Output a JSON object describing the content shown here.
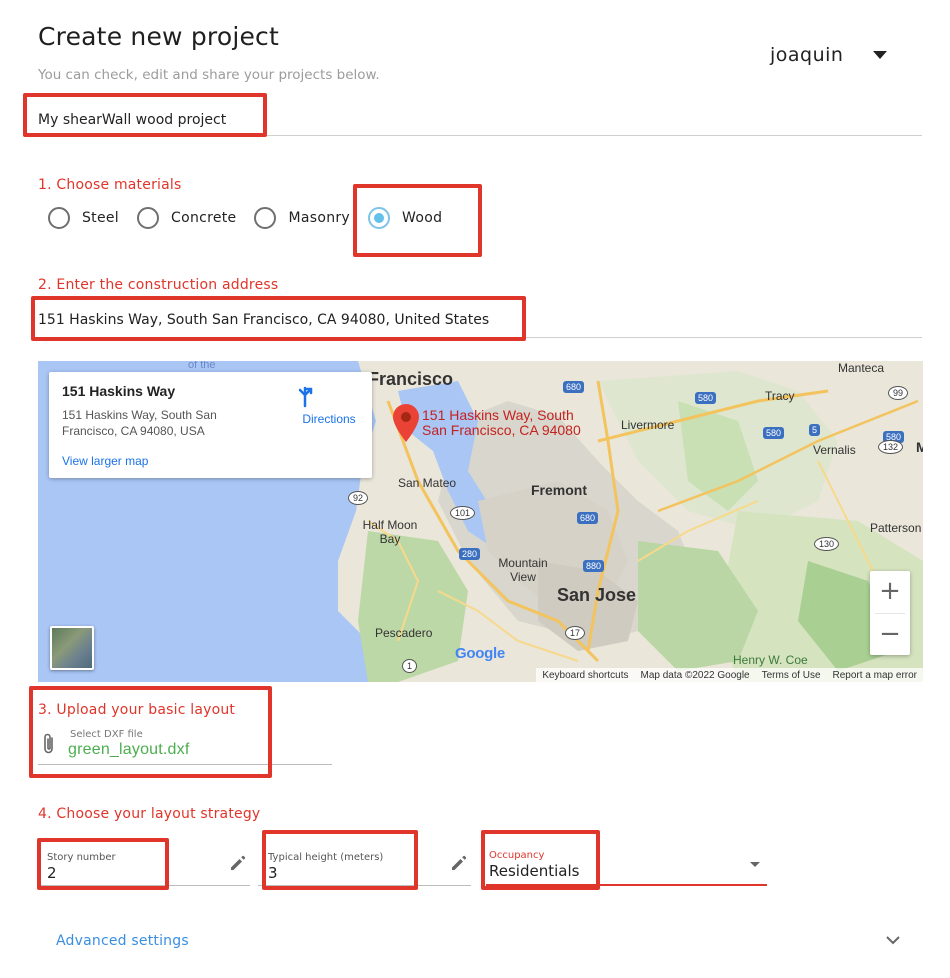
{
  "header": {
    "title": "Create new project",
    "subtitle": "You can check, edit and share your projects below.",
    "user_name": "joaquin"
  },
  "project": {
    "name": "My shearWall wood project"
  },
  "materials": {
    "label": "1. Choose materials",
    "options": [
      {
        "label": "Steel",
        "checked": false
      },
      {
        "label": "Concrete",
        "checked": false
      },
      {
        "label": "Masonry",
        "checked": false
      },
      {
        "label": "Wood",
        "checked": true
      }
    ],
    "accent": "#62c2ec"
  },
  "address": {
    "label": "2. Enter the construction address",
    "value": "151 Haskins Way, South San Francisco, CA 94080, United States"
  },
  "map": {
    "card_title": "151 Haskins Way",
    "card_address": "151 Haskins Way, South San Francisco, CA 94080, USA",
    "directions_label": "Directions",
    "larger_map_label": "View larger map",
    "pin_label": "151 Haskins Way, South San Francisco, CA 94080",
    "city_labels": {
      "san_francisco": "Francisco",
      "san_mateo": "San Mateo",
      "half_moon_bay": "Half Moon Bay",
      "fremont": "Fremont",
      "san_jose": "San Jose",
      "mountain_view": "Mountain View",
      "pescadero": "Pescadero",
      "livermore": "Livermore",
      "tracy": "Tracy",
      "manteca": "Manteca",
      "vernalis": "Vernalis",
      "patterson": "Patterson",
      "henry_w_coe": "Henry W. Coe",
      "of_the": "of the"
    },
    "shields": {
      "i680a": "680",
      "i580a": "580",
      "i580b": "580",
      "i5": "5",
      "i580c": "580",
      "i680b": "680",
      "i880": "880",
      "i280": "280",
      "s99": "99",
      "s132": "132",
      "s101": "101",
      "s92": "92",
      "s130": "130",
      "s17": "17",
      "s1": "1",
      "m_partial": "M"
    },
    "zoom_in": "+",
    "zoom_out": "−",
    "google_logo": "Google",
    "footer": {
      "shortcuts": "Keyboard shortcuts",
      "map_data": "Map data ©2022 Google",
      "terms": "Terms of Use",
      "report": "Report a map error"
    }
  },
  "upload": {
    "label": "3. Upload your basic layout",
    "hint": "Select DXF file",
    "file_name": "green_layout.dxf"
  },
  "strategy": {
    "label": "4. Choose your layout strategy",
    "story": {
      "label": "Story number",
      "value": "2"
    },
    "height": {
      "label": "Typical height (meters)",
      "value": "3"
    },
    "occupancy": {
      "label": "Occupancy",
      "value": "Residentials"
    }
  },
  "advanced": {
    "label": "Advanced settings"
  },
  "colors": {
    "highlight": "#e0352b",
    "section_label": "#e0352b",
    "link": "#3a8ee0",
    "file_name": "#4cae4f"
  }
}
